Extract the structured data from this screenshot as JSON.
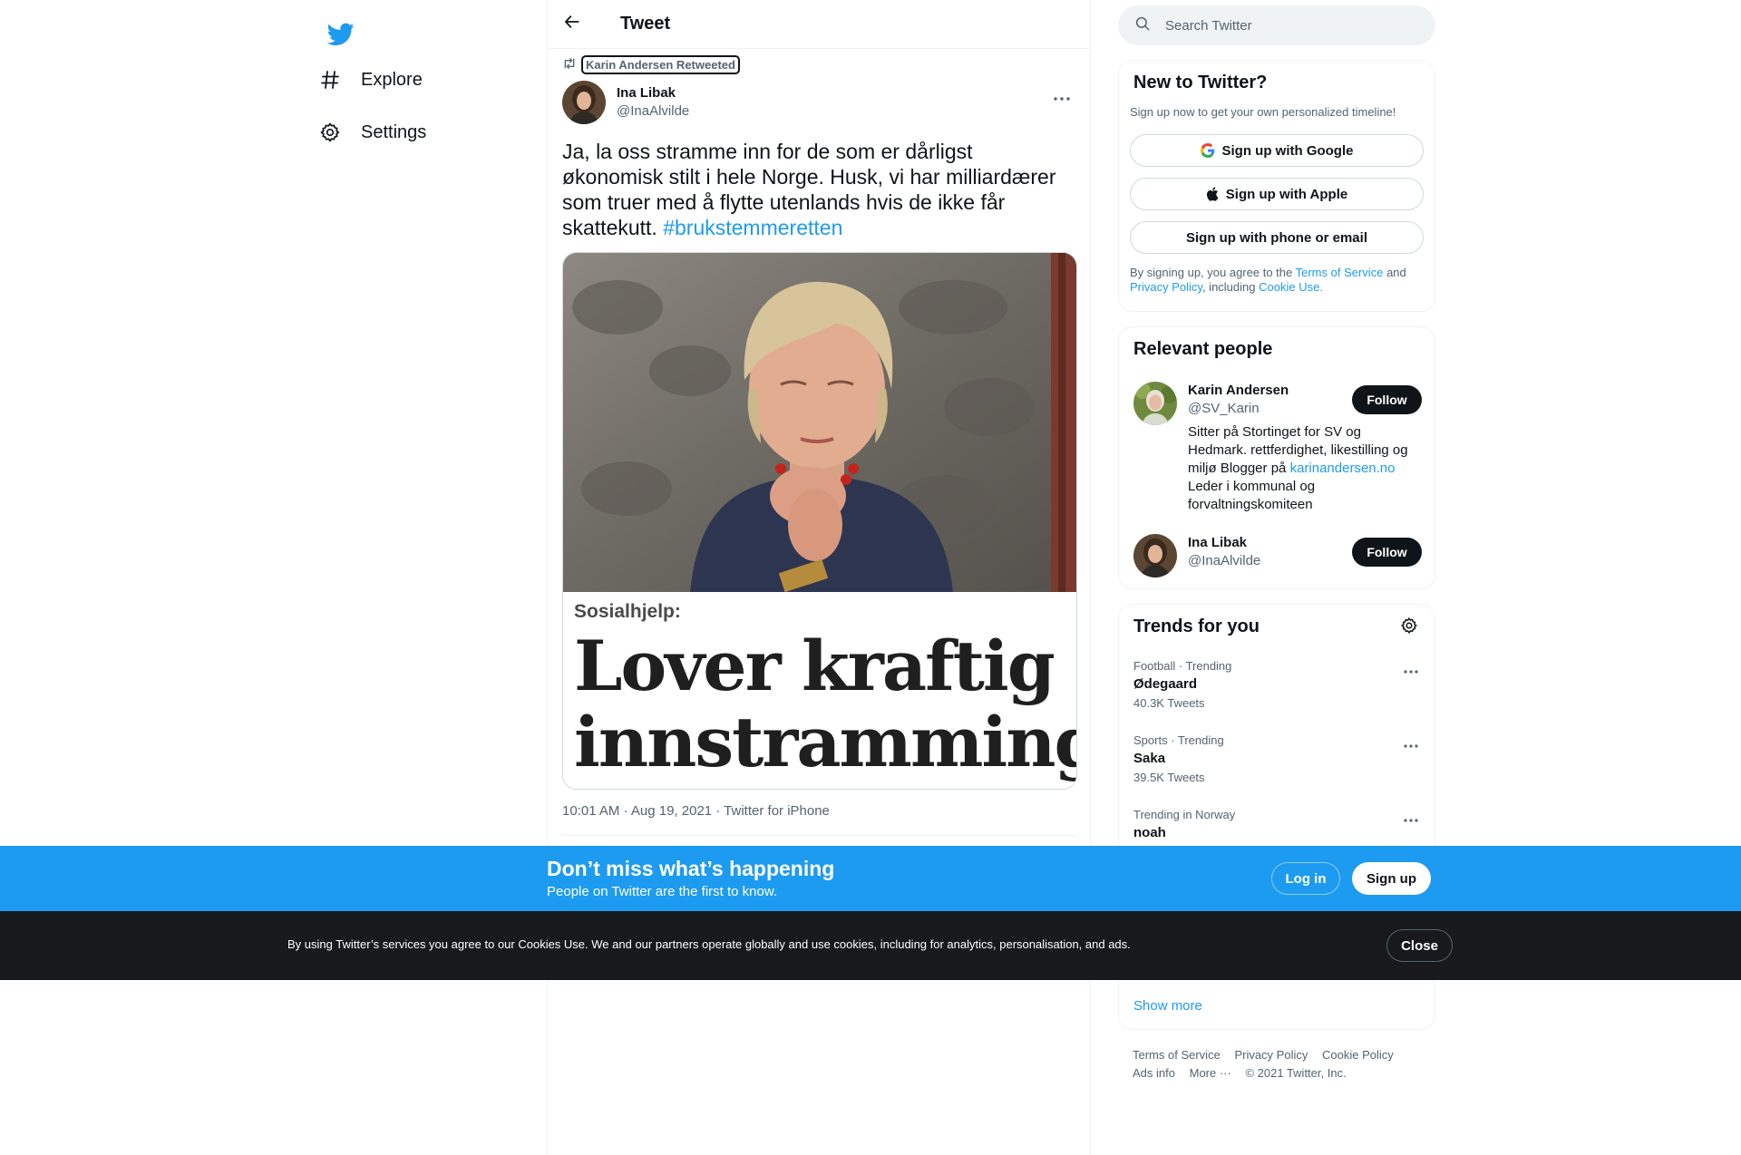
{
  "nav": {
    "logo_icon": "twitter-bird-icon",
    "items": [
      {
        "label": "Explore",
        "icon": "hashtag-icon"
      },
      {
        "label": "Settings",
        "icon": "gear-icon"
      }
    ]
  },
  "header": {
    "title": "Tweet",
    "back_icon": "arrow-left-icon"
  },
  "tweet": {
    "retweeted_by": "Karin Andersen Retweeted",
    "author_name": "Ina Libak",
    "author_handle": "@InaAlvilde",
    "text": "Ja, la oss stramme inn for de som er dårligst økonomisk stilt i hele Norge. Husk, vi har milliardærer som truer med å flytte utenlands hvis de ikke får skattekutt.",
    "hashtag": "#brukstemmeretten",
    "media": {
      "kicker": "Sosialhjelp:",
      "headline_1": "Lover kraftig",
      "headline_2": "innstramming"
    },
    "meta": "10:01 AM · Aug 19, 2021 · Twitter for iPhone"
  },
  "search": {
    "placeholder": "Search Twitter"
  },
  "new_to_twitter": {
    "title": "New to Twitter?",
    "subtitle": "Sign up now to get your own personalized timeline!",
    "google_label": "Sign up with Google",
    "apple_label": "Sign up with Apple",
    "phone_label": "Sign up with phone or email",
    "legal_1": "By signing up, you agree to the",
    "legal_tos": "Terms of Service",
    "legal_and": "and",
    "legal_privacy": "Privacy Policy",
    "legal_including": ", including",
    "legal_cookie": "Cookie Use."
  },
  "relevant_people": {
    "title": "Relevant people",
    "people": [
      {
        "name": "Karin Andersen",
        "handle": "@SV_Karin",
        "bio_1": "Sitter på Stortinget for SV og Hedmark. rettferdighet, likestilling og miljø Blogger på",
        "bio_link": "karinandersen.no",
        "bio_2": "Leder i kommunal og forvaltningskomiteen",
        "follow_label": "Follow"
      },
      {
        "name": "Ina Libak",
        "handle": "@InaAlvilde",
        "follow_label": "Follow"
      }
    ]
  },
  "trends": {
    "title": "Trends for you",
    "items": [
      {
        "category": "Football · Trending",
        "name": "Ødegaard",
        "count": "40.3K Tweets"
      },
      {
        "category": "Sports · Trending",
        "name": "Saka",
        "count": "39.5K Tweets"
      },
      {
        "category": "Trending in Norway",
        "name": "noah",
        "count": ""
      }
    ],
    "show_more": "Show more"
  },
  "footer": {
    "links": [
      "Terms of Service",
      "Privacy Policy",
      "Cookie Policy",
      "Ads info",
      "More ···",
      "© 2021 Twitter, Inc."
    ]
  },
  "banner": {
    "title": "Don’t miss what’s happening",
    "subtitle": "People on Twitter are the first to know.",
    "login_label": "Log in",
    "signup_label": "Sign up"
  },
  "cookie": {
    "text": "By using Twitter’s services you agree to our Cookies Use. We and our partners operate globally and use cookies, including for analytics, personalisation, and ads.",
    "close_label": "Close"
  },
  "colors": {
    "brand": "#1d9bf0",
    "text_primary": "#0f1419",
    "text_secondary": "#536471",
    "cookie_bg": "#17191c"
  }
}
